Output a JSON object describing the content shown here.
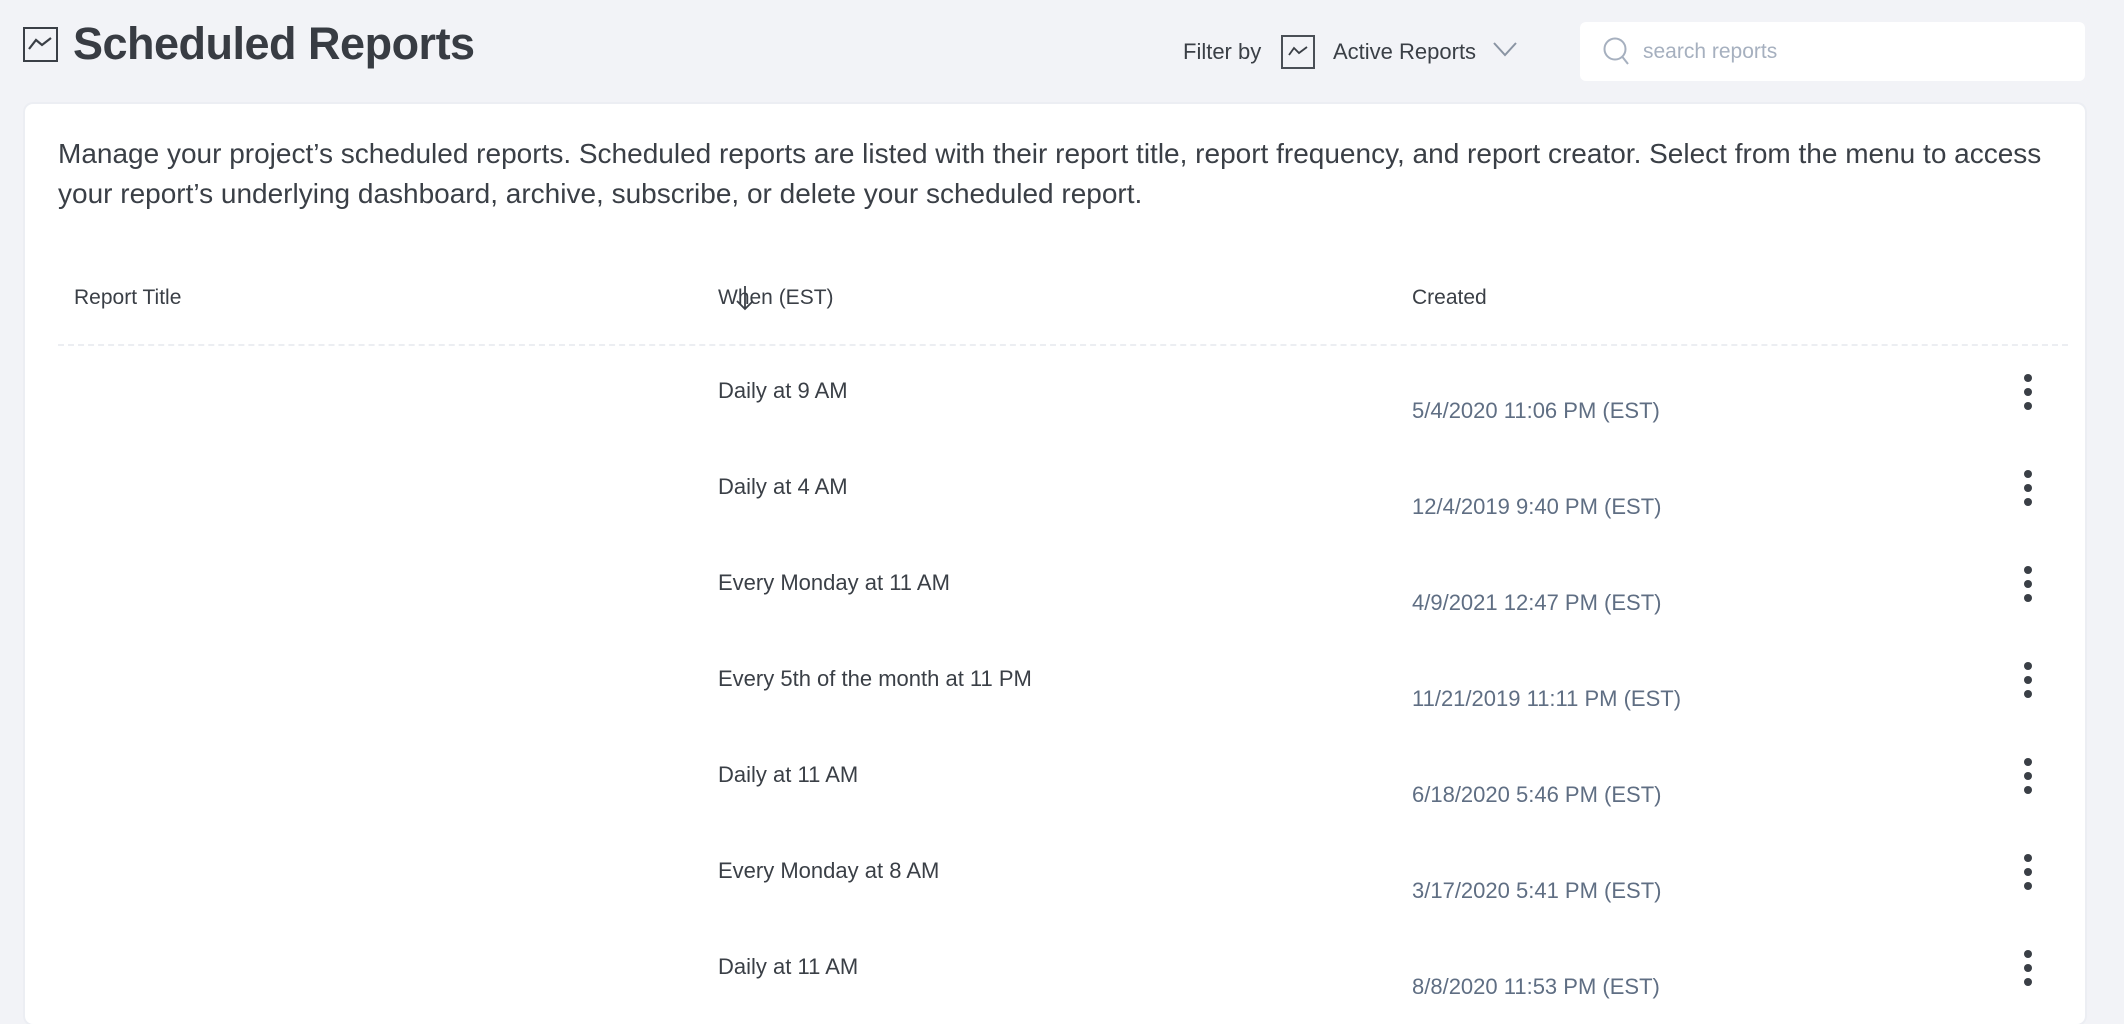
{
  "header": {
    "title": "Scheduled Reports",
    "title_icon": "line-chart-icon",
    "filter": {
      "label": "Filter by",
      "icon": "line-chart-icon",
      "selected": "Active Reports",
      "chevron_icon": "chevron-down-icon"
    },
    "search": {
      "placeholder": "search reports",
      "value": "",
      "icon": "search-icon"
    }
  },
  "main": {
    "description": "Manage your project’s scheduled reports. Scheduled reports are listed with their report title, report frequency, and report creator. Select from the menu to access your report’s underlying dashboard, archive, subscribe, or delete your scheduled report.",
    "table": {
      "columns": [
        {
          "label": "Report Title",
          "sort_icon": "arrow-down-icon"
        },
        {
          "label": "When (EST)"
        },
        {
          "label": "Created"
        }
      ],
      "rows": [
        {
          "title": "",
          "when": "Daily at 9 AM",
          "created": "5/4/2020 11:06 PM (EST)"
        },
        {
          "title": "",
          "when": "Daily at 4 AM",
          "created": "12/4/2019 9:40 PM (EST)"
        },
        {
          "title": "",
          "when": "Every Monday at 11 AM",
          "created": "4/9/2021 12:47 PM (EST)"
        },
        {
          "title": "",
          "when": "Every 5th of the month at 11 PM",
          "created": "11/21/2019 11:11 PM (EST)"
        },
        {
          "title": "",
          "when": "Daily at 11 AM",
          "created": "6/18/2020 5:46 PM (EST)"
        },
        {
          "title": "",
          "when": "Every Monday at 8 AM",
          "created": "3/17/2020 5:41 PM (EST)"
        },
        {
          "title": "",
          "when": "Daily at 11 AM",
          "created": "8/8/2020 11:53 PM (EST)"
        }
      ],
      "row_menu_icon": "kebab-menu-icon"
    }
  },
  "colors": {
    "background": "#f2f3f7",
    "card": "#ffffff",
    "text_primary": "#3a3f46",
    "text_date": "#5f6e83",
    "placeholder": "#a6b0bf"
  }
}
